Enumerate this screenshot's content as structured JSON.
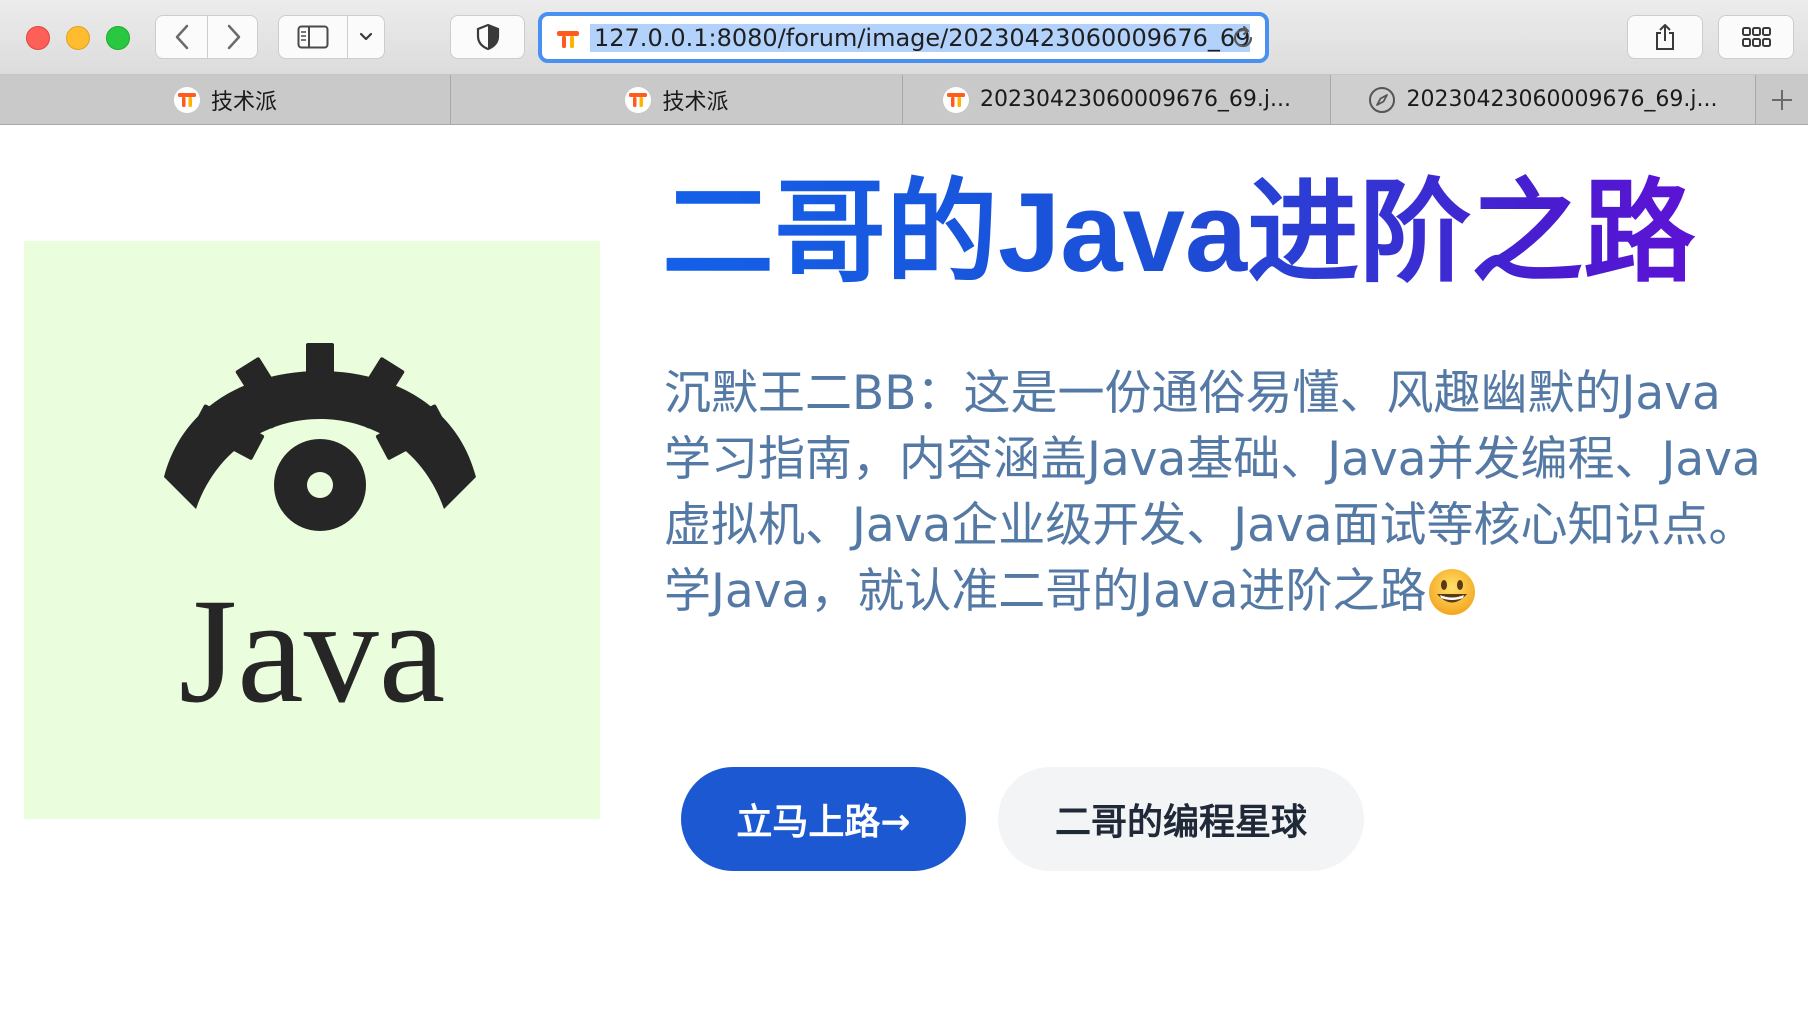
{
  "browser": {
    "url": "127.0.0.1:8080/forum/image/20230423060009676_69.",
    "tabs": [
      {
        "label": "技术派",
        "icon": "techpai-favicon-icon"
      },
      {
        "label": "技术派",
        "icon": "techpai-favicon-icon"
      },
      {
        "label": "20230423060009676_69.j...",
        "icon": "techpai-favicon-icon"
      },
      {
        "label": "20230423060009676_69.j...",
        "icon": "compass-icon"
      }
    ],
    "colors": {
      "url_highlight": "#b3d2fb",
      "focus_ring": "#4a90f0"
    }
  },
  "page": {
    "logo_text": "Java",
    "logo_background": "#eafddc",
    "title": "二哥的Java进阶之路",
    "description": "沉默王二BB：这是一份通俗易懂、风趣幽默的Java学习指南，内容涵盖Java基础、Java并发编程、Java虚拟机、Java企业级开发、Java面试等核心知识点。学Java，就认准二哥的Java进阶之路",
    "description_emoji": "grinning-face-emoji",
    "primary_button": "立马上路→",
    "secondary_button": "二哥的编程星球",
    "colors": {
      "title_start": "#1460e8",
      "title_end": "#6a0fd8",
      "primary_button": "#1c58d2",
      "description": "#5479a5"
    }
  }
}
